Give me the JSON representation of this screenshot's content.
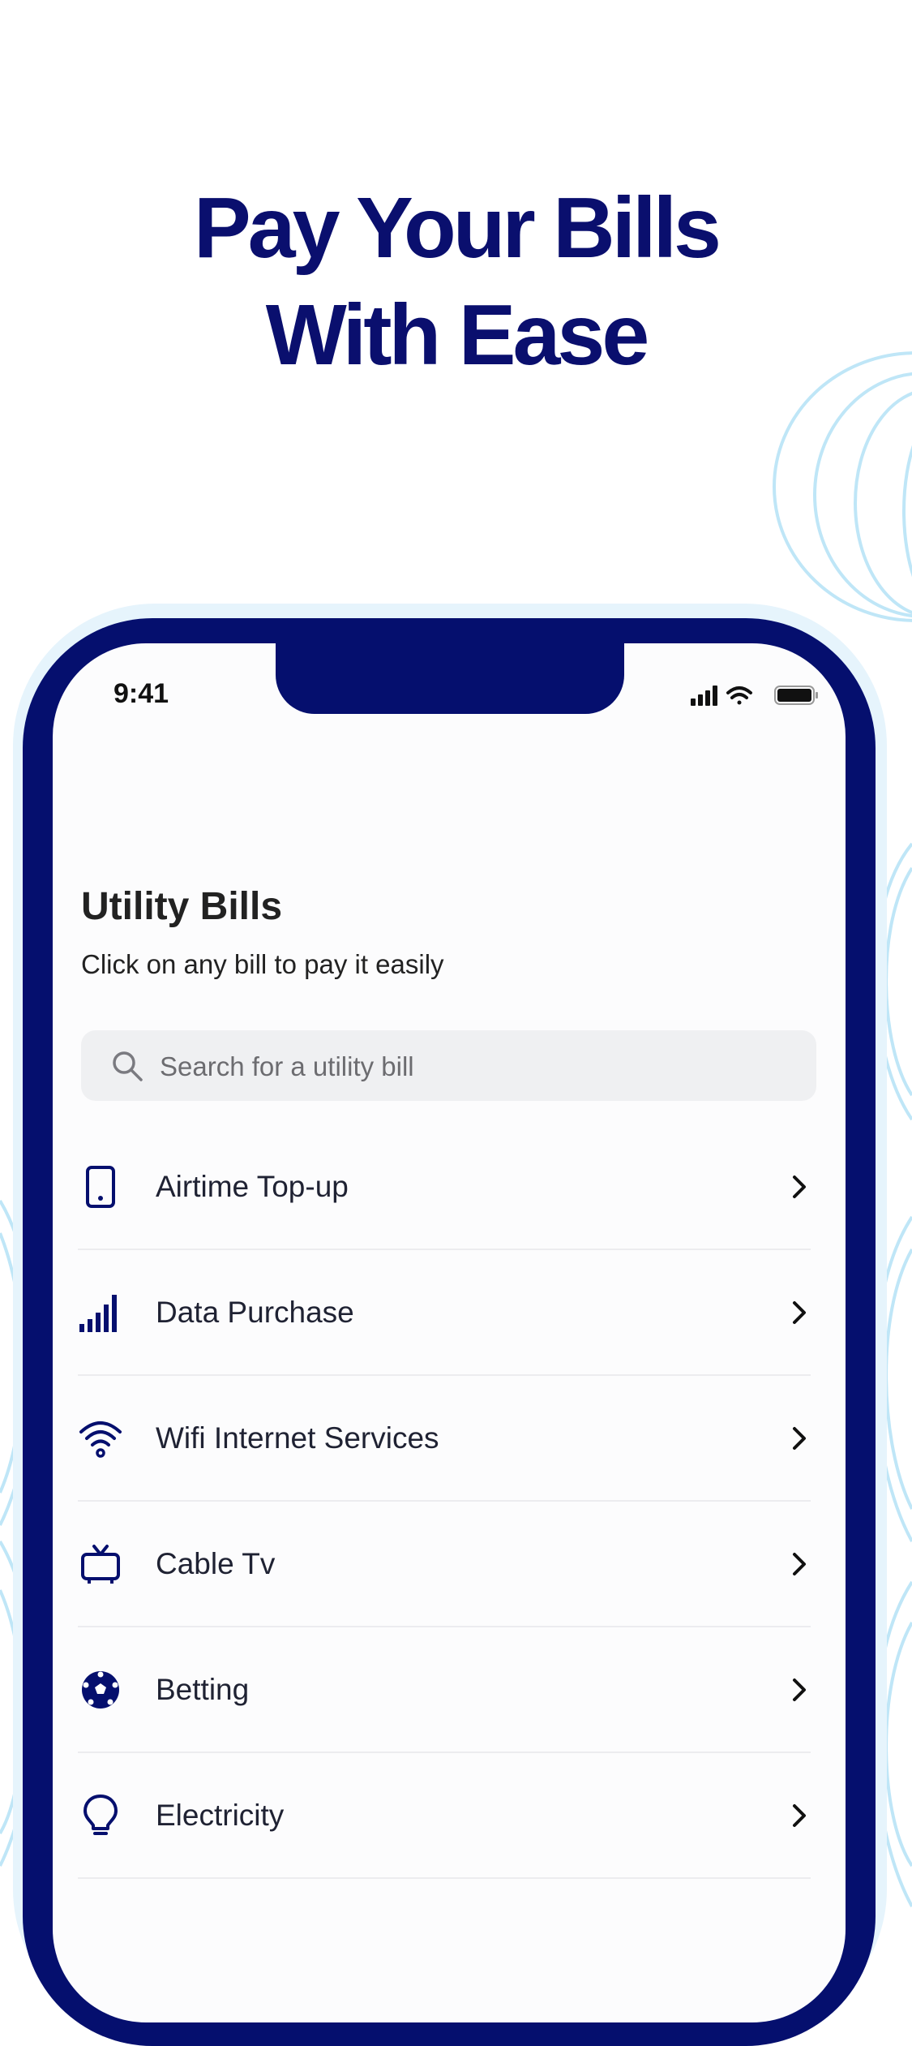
{
  "headline": {
    "line1": "Pay Your Bills",
    "line2": "With Ease"
  },
  "status_bar": {
    "time": "9:41",
    "icons": [
      "cellular-signal-icon",
      "wifi-icon",
      "battery-icon"
    ]
  },
  "screen": {
    "title": "Utility Bills",
    "subtitle": "Click on any bill to pay it easily",
    "search": {
      "placeholder": "Search for a utility bill",
      "value": ""
    },
    "items": [
      {
        "label": "Airtime Top-up",
        "icon": "phone-icon"
      },
      {
        "label": "Data Purchase",
        "icon": "signal-bars-icon"
      },
      {
        "label": "Wifi Internet Services",
        "icon": "wifi-icon"
      },
      {
        "label": "Cable Tv",
        "icon": "tv-icon"
      },
      {
        "label": "Betting",
        "icon": "soccer-ball-icon"
      },
      {
        "label": "Electricity",
        "icon": "lightbulb-icon"
      }
    ]
  },
  "colors": {
    "brand_navy": "#050f6e",
    "headline": "#0a0f6e",
    "decor_light_blue": "#bfe6f7",
    "search_bg": "#eff0f2"
  }
}
